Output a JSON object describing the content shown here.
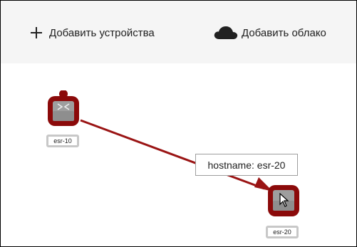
{
  "toolbar": {
    "add_device_label": "Добавить устройства",
    "add_device_icon": "plus-icon",
    "add_cloud_label": "Добавить облако",
    "add_cloud_icon": "cloud-icon"
  },
  "topology": {
    "nodes": [
      {
        "id": "esr-10",
        "label": "esr-10",
        "icon": "router-icon"
      },
      {
        "id": "esr-20",
        "label": "esr-20",
        "icon": "router-icon"
      }
    ],
    "links": [
      {
        "from": "esr-10",
        "to": "esr-20"
      }
    ],
    "tooltip": "hostname: esr-20",
    "selection_color": "#8b0a0a",
    "link_color": "#9a1414"
  }
}
